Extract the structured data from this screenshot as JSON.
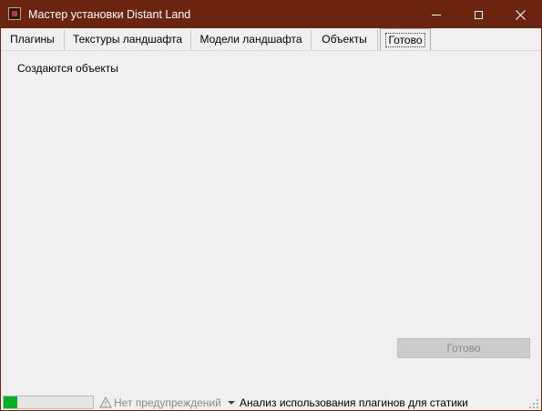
{
  "window": {
    "title": "Мастер установки Distant Land"
  },
  "tabs": [
    {
      "label": "Плагины"
    },
    {
      "label": "Текстуры ландшафта"
    },
    {
      "label": "Модели ландшафта"
    },
    {
      "label": "Объекты"
    },
    {
      "label": "Готово",
      "active": true
    }
  ],
  "main": {
    "status_text": "Создаются объекты",
    "done_button": "Готово"
  },
  "statusbar": {
    "progress_percent": 15,
    "warnings_text": "Нет предупреждений",
    "analysis_text": "Анализ использования плагинов для статики"
  },
  "colors": {
    "titlebar": "#6b2410",
    "progress": "#06b025"
  }
}
